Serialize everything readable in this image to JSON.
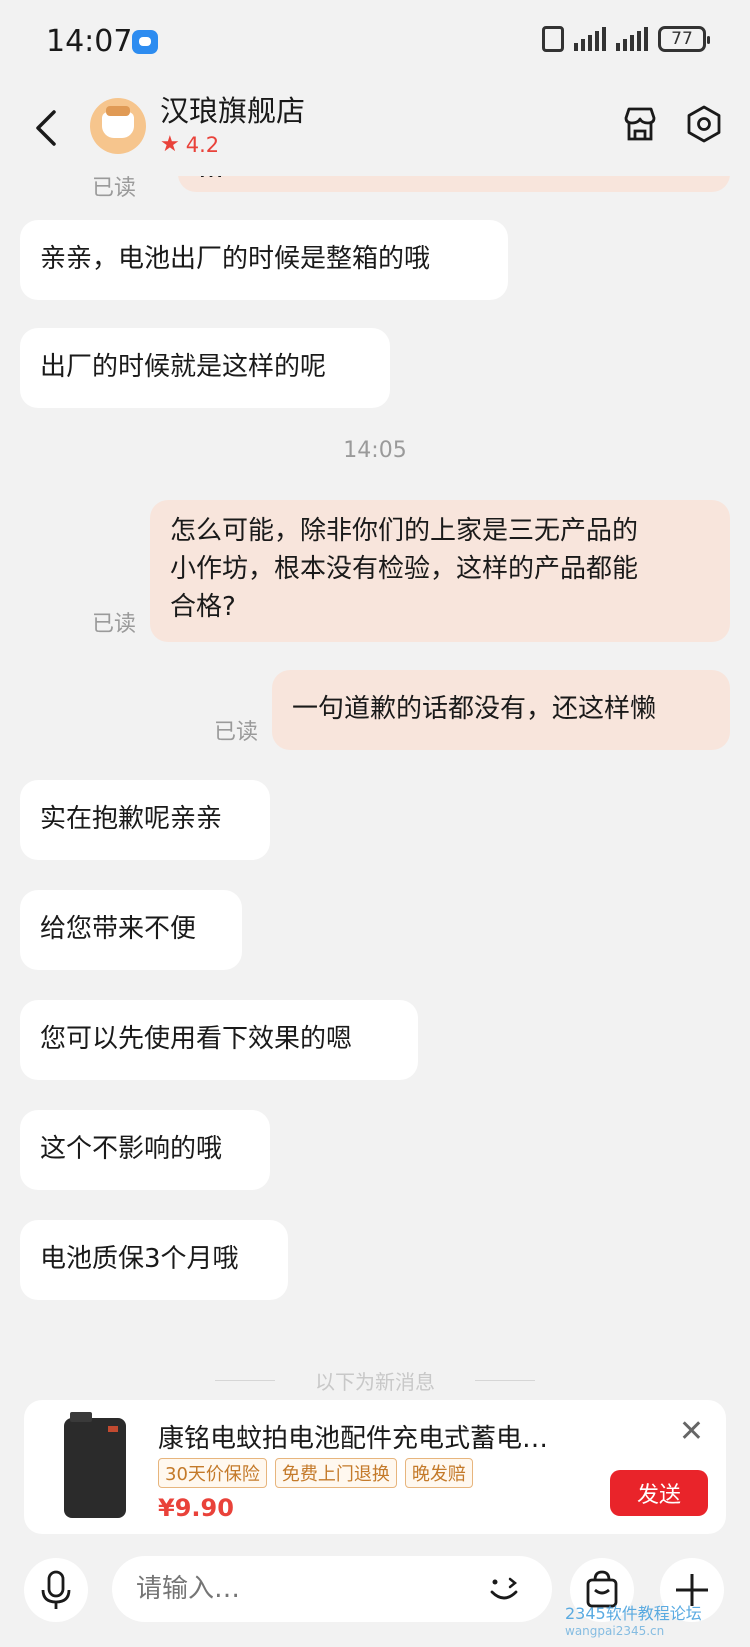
{
  "status_bar": {
    "time": "14:07",
    "battery": "77"
  },
  "header": {
    "shop_name": "汉琅旗舰店",
    "rating": "4.2"
  },
  "messages": {
    "top_partial_out": "…",
    "top_partial_read": "已读",
    "m1": "亲亲，电池出厂的时候是整箱的哦",
    "m2": "出厂的时候就是这样的呢",
    "timestamp": "14:05",
    "m3_line1": "怎么可能，除非你们的上家是三无产品的",
    "m3_line2": "小作坊，根本没有检验，这样的产品都能",
    "m3_line3": "合格?",
    "m3_read": "已读",
    "m4": "一句道歉的话都没有，还这样懒",
    "m4_read": "已读",
    "m5": "实在抱歉呢亲亲",
    "m6": "给您带来不便",
    "m7": "您可以先使用看下效果的嗯",
    "m8": "这个不影响的哦",
    "m9": "电池质保3个月哦",
    "new_divider": "以下为新消息"
  },
  "product": {
    "title": "康铭电蚊拍电池配件充电式蓄电…",
    "tags": [
      "30天价保险",
      "免费上门退换",
      "晚发赔"
    ],
    "price": "¥9.90",
    "send_label": "发送"
  },
  "input": {
    "placeholder": "请输入…"
  },
  "watermark": {
    "line1": "2345软件教程论坛",
    "line2": "wangpai2345.cn"
  }
}
